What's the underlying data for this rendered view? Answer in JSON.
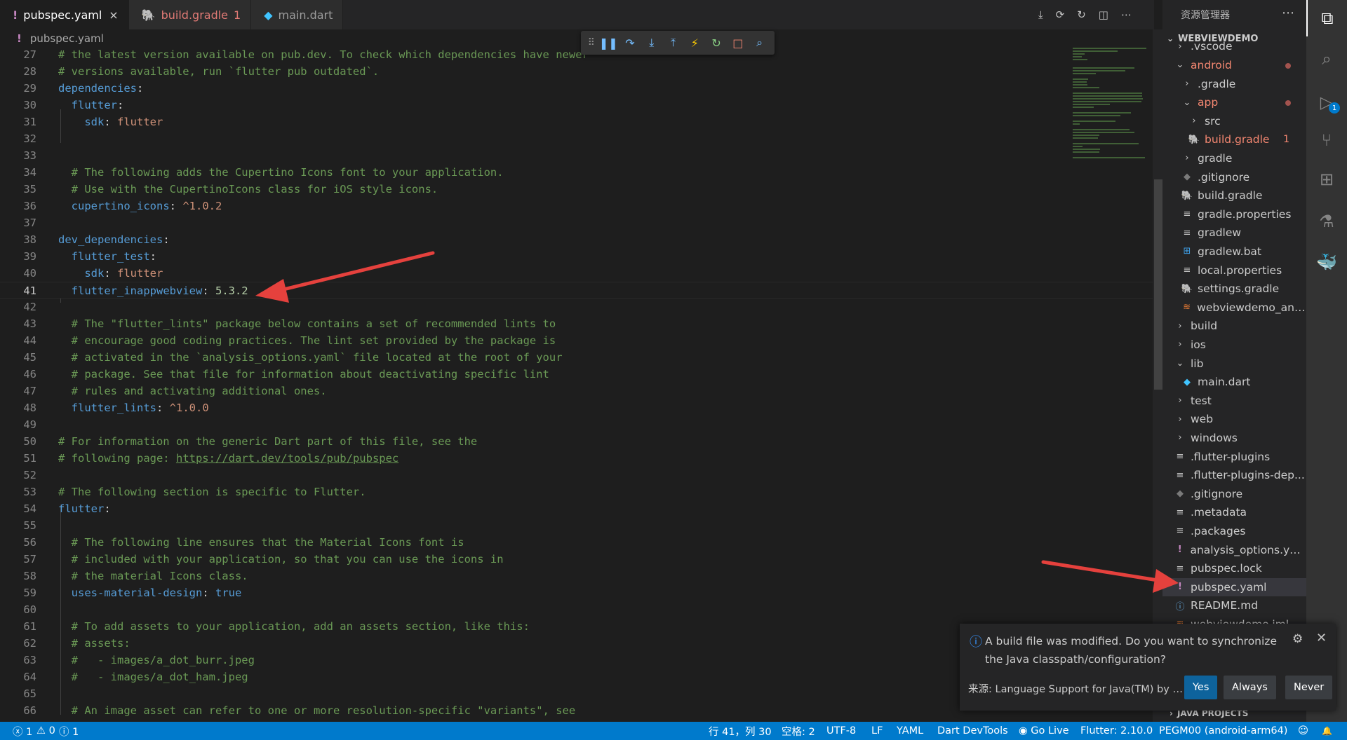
{
  "tabs": [
    {
      "label": "pubspec.yaml",
      "icon": "!",
      "icon_name": "yaml-icon",
      "active": true,
      "close": "×"
    },
    {
      "label": "build.gradle",
      "icon": "🐘",
      "icon_name": "gradle-icon",
      "badge": "1",
      "error": true
    },
    {
      "label": "main.dart",
      "icon": "◆",
      "icon_name": "dart-icon"
    }
  ],
  "tab_actions": [
    "⤓",
    "⟳",
    "↻",
    "◫",
    "⋯"
  ],
  "breadcrumb": {
    "icon": "!",
    "file": "pubspec.yaml"
  },
  "debug_toolbar": {
    "grip": "⠿",
    "pause": "❚❚",
    "step_over": "↷",
    "step_into": "⤓",
    "step_out": "⤒",
    "hot_reload": "⚡",
    "restart": "↻",
    "stop": "□",
    "inspect": "⌕"
  },
  "code_lines": [
    {
      "n": "27",
      "t": [
        {
          "c": "comment",
          "s": "# the latest version available on pub.dev. To check which dependencies have newer"
        }
      ]
    },
    {
      "n": "28",
      "t": [
        {
          "c": "comment",
          "s": "# versions available, run `flutter pub outdated`."
        }
      ]
    },
    {
      "n": "29",
      "t": [
        {
          "c": "key",
          "s": "dependencies"
        },
        {
          "c": "punct",
          "s": ":"
        }
      ]
    },
    {
      "n": "30",
      "t": [
        {
          "c": "plain",
          "s": "  "
        },
        {
          "c": "key",
          "s": "flutter"
        },
        {
          "c": "punct",
          "s": ":"
        }
      ]
    },
    {
      "n": "31",
      "t": [
        {
          "c": "plain",
          "s": "    "
        },
        {
          "c": "key",
          "s": "sdk"
        },
        {
          "c": "punct",
          "s": ": "
        },
        {
          "c": "plain",
          "s": "flutter"
        }
      ]
    },
    {
      "n": "32",
      "t": []
    },
    {
      "n": "33",
      "t": []
    },
    {
      "n": "34",
      "t": [
        {
          "c": "plain",
          "s": "  "
        },
        {
          "c": "comment",
          "s": "# The following adds the Cupertino Icons font to your application."
        }
      ]
    },
    {
      "n": "35",
      "t": [
        {
          "c": "plain",
          "s": "  "
        },
        {
          "c": "comment",
          "s": "# Use with the CupertinoIcons class for iOS style icons."
        }
      ]
    },
    {
      "n": "36",
      "t": [
        {
          "c": "plain",
          "s": "  "
        },
        {
          "c": "key",
          "s": "cupertino_icons"
        },
        {
          "c": "punct",
          "s": ": "
        },
        {
          "c": "plain",
          "s": "^1.0.2"
        }
      ]
    },
    {
      "n": "37",
      "t": []
    },
    {
      "n": "38",
      "t": [
        {
          "c": "key",
          "s": "dev_dependencies"
        },
        {
          "c": "punct",
          "s": ":"
        }
      ]
    },
    {
      "n": "39",
      "t": [
        {
          "c": "plain",
          "s": "  "
        },
        {
          "c": "key",
          "s": "flutter_test"
        },
        {
          "c": "punct",
          "s": ":"
        }
      ]
    },
    {
      "n": "40",
      "t": [
        {
          "c": "plain",
          "s": "    "
        },
        {
          "c": "key",
          "s": "sdk"
        },
        {
          "c": "punct",
          "s": ": "
        },
        {
          "c": "plain",
          "s": "flutter"
        }
      ]
    },
    {
      "n": "41",
      "t": [
        {
          "c": "plain",
          "s": "  "
        },
        {
          "c": "key",
          "s": "flutter_inappwebview"
        },
        {
          "c": "punct",
          "s": ": "
        },
        {
          "c": "num",
          "s": "5.3.2"
        }
      ],
      "current": true
    },
    {
      "n": "42",
      "t": []
    },
    {
      "n": "43",
      "t": [
        {
          "c": "plain",
          "s": "  "
        },
        {
          "c": "comment",
          "s": "# The \"flutter_lints\" package below contains a set of recommended lints to"
        }
      ]
    },
    {
      "n": "44",
      "t": [
        {
          "c": "plain",
          "s": "  "
        },
        {
          "c": "comment",
          "s": "# encourage good coding practices. The lint set provided by the package is"
        }
      ]
    },
    {
      "n": "45",
      "t": [
        {
          "c": "plain",
          "s": "  "
        },
        {
          "c": "comment",
          "s": "# activated in the `analysis_options.yaml` file located at the root of your"
        }
      ]
    },
    {
      "n": "46",
      "t": [
        {
          "c": "plain",
          "s": "  "
        },
        {
          "c": "comment",
          "s": "# package. See that file for information about deactivating specific lint"
        }
      ]
    },
    {
      "n": "47",
      "t": [
        {
          "c": "plain",
          "s": "  "
        },
        {
          "c": "comment",
          "s": "# rules and activating additional ones."
        }
      ]
    },
    {
      "n": "48",
      "t": [
        {
          "c": "plain",
          "s": "  "
        },
        {
          "c": "key",
          "s": "flutter_lints"
        },
        {
          "c": "punct",
          "s": ": "
        },
        {
          "c": "plain",
          "s": "^1.0.0"
        }
      ]
    },
    {
      "n": "49",
      "t": []
    },
    {
      "n": "50",
      "t": [
        {
          "c": "comment",
          "s": "# For information on the generic Dart part of this file, see the"
        }
      ]
    },
    {
      "n": "51",
      "t": [
        {
          "c": "comment",
          "s": "# following page: "
        },
        {
          "c": "link",
          "s": "https://dart.dev/tools/pub/pubspec"
        }
      ]
    },
    {
      "n": "52",
      "t": []
    },
    {
      "n": "53",
      "t": [
        {
          "c": "comment",
          "s": "# The following section is specific to Flutter."
        }
      ]
    },
    {
      "n": "54",
      "t": [
        {
          "c": "key",
          "s": "flutter"
        },
        {
          "c": "punct",
          "s": ":"
        }
      ]
    },
    {
      "n": "55",
      "t": []
    },
    {
      "n": "56",
      "t": [
        {
          "c": "plain",
          "s": "  "
        },
        {
          "c": "comment",
          "s": "# The following line ensures that the Material Icons font is"
        }
      ]
    },
    {
      "n": "57",
      "t": [
        {
          "c": "plain",
          "s": "  "
        },
        {
          "c": "comment",
          "s": "# included with your application, so that you can use the icons in"
        }
      ]
    },
    {
      "n": "58",
      "t": [
        {
          "c": "plain",
          "s": "  "
        },
        {
          "c": "comment",
          "s": "# the material Icons class."
        }
      ]
    },
    {
      "n": "59",
      "t": [
        {
          "c": "plain",
          "s": "  "
        },
        {
          "c": "key",
          "s": "uses-material-design"
        },
        {
          "c": "punct",
          "s": ": "
        },
        {
          "c": "bool",
          "s": "true"
        }
      ]
    },
    {
      "n": "60",
      "t": []
    },
    {
      "n": "61",
      "t": [
        {
          "c": "plain",
          "s": "  "
        },
        {
          "c": "comment",
          "s": "# To add assets to your application, add an assets section, like this:"
        }
      ]
    },
    {
      "n": "62",
      "t": [
        {
          "c": "plain",
          "s": "  "
        },
        {
          "c": "comment",
          "s": "# assets:"
        }
      ]
    },
    {
      "n": "63",
      "t": [
        {
          "c": "plain",
          "s": "  "
        },
        {
          "c": "comment",
          "s": "#   - images/a_dot_burr.jpeg"
        }
      ]
    },
    {
      "n": "64",
      "t": [
        {
          "c": "plain",
          "s": "  "
        },
        {
          "c": "comment",
          "s": "#   - images/a_dot_ham.jpeg"
        }
      ]
    },
    {
      "n": "65",
      "t": []
    },
    {
      "n": "66",
      "t": [
        {
          "c": "plain",
          "s": "  "
        },
        {
          "c": "comment",
          "s": "# An image asset can refer to one or more resolution-specific \"variants\", see"
        }
      ]
    }
  ],
  "explorer": {
    "title": "资源管理器",
    "more": "⋯",
    "project": "WEBVIEWDEMO",
    "items": [
      {
        "label": ".vscode",
        "depth": 2,
        "icon": "›",
        "icon_name": "chevron-right-icon"
      },
      {
        "label": "android",
        "depth": 2,
        "icon": "⌄",
        "icon_name": "chevron-down-icon",
        "error": true,
        "dot": true
      },
      {
        "label": ".gradle",
        "depth": 3,
        "icon": "›",
        "icon_name": "chevron-right-icon"
      },
      {
        "label": "app",
        "depth": 3,
        "icon": "⌄",
        "icon_name": "chevron-down-icon",
        "error": true,
        "dot": true
      },
      {
        "label": "src",
        "depth": 4,
        "icon": "›",
        "icon_name": "chevron-right-icon"
      },
      {
        "label": "build.gradle",
        "depth": 4,
        "icon": "🐘",
        "icon_name": "gradle-icon",
        "icon_class": "icon-gradle",
        "error": true,
        "badge": "1"
      },
      {
        "label": "gradle",
        "depth": 3,
        "icon": "›",
        "icon_name": "chevron-right-icon"
      },
      {
        "label": ".gitignore",
        "depth": 3,
        "icon": "◆",
        "icon_name": "git-icon",
        "icon_class": "icon-git"
      },
      {
        "label": "build.gradle",
        "depth": 3,
        "icon": "🐘",
        "icon_name": "gradle-icon",
        "icon_class": "icon-gradle"
      },
      {
        "label": "gradle.properties",
        "depth": 3,
        "icon": "≡",
        "icon_name": "file-lines-icon"
      },
      {
        "label": "gradlew",
        "depth": 3,
        "icon": "≡",
        "icon_name": "file-lines-icon"
      },
      {
        "label": "gradlew.bat",
        "depth": 3,
        "icon": "⊞",
        "icon_name": "windows-icon",
        "icon_class": "icon-win"
      },
      {
        "label": "local.properties",
        "depth": 3,
        "icon": "≡",
        "icon_name": "file-lines-icon"
      },
      {
        "label": "settings.gradle",
        "depth": 3,
        "icon": "🐘",
        "icon_name": "gradle-icon",
        "icon_class": "icon-gradle"
      },
      {
        "label": "webviewdemo_and...",
        "depth": 3,
        "icon": "≋",
        "icon_name": "rss-icon",
        "icon_class": "icon-rss"
      },
      {
        "label": "build",
        "depth": 2,
        "icon": "›",
        "icon_name": "chevron-right-icon"
      },
      {
        "label": "ios",
        "depth": 2,
        "icon": "›",
        "icon_name": "chevron-right-icon"
      },
      {
        "label": "lib",
        "depth": 2,
        "icon": "⌄",
        "icon_name": "chevron-down-icon"
      },
      {
        "label": "main.dart",
        "depth": 3,
        "icon": "◆",
        "icon_name": "dart-icon",
        "icon_class": "icon-dart"
      },
      {
        "label": "test",
        "depth": 2,
        "icon": "›",
        "icon_name": "chevron-right-icon"
      },
      {
        "label": "web",
        "depth": 2,
        "icon": "›",
        "icon_name": "chevron-right-icon"
      },
      {
        "label": "windows",
        "depth": 2,
        "icon": "›",
        "icon_name": "chevron-right-icon"
      },
      {
        "label": ".flutter-plugins",
        "depth": 2,
        "icon": "≡",
        "icon_name": "file-lines-icon"
      },
      {
        "label": ".flutter-plugins-dep...",
        "depth": 2,
        "icon": "≡",
        "icon_name": "file-lines-icon"
      },
      {
        "label": ".gitignore",
        "depth": 2,
        "icon": "◆",
        "icon_name": "git-icon",
        "icon_class": "icon-git"
      },
      {
        "label": ".metadata",
        "depth": 2,
        "icon": "≡",
        "icon_name": "file-lines-icon"
      },
      {
        "label": ".packages",
        "depth": 2,
        "icon": "≡",
        "icon_name": "file-lines-icon"
      },
      {
        "label": "analysis_options.yaml",
        "depth": 2,
        "icon": "!",
        "icon_name": "yaml-icon",
        "icon_class": "icon-yaml"
      },
      {
        "label": "pubspec.lock",
        "depth": 2,
        "icon": "≡",
        "icon_name": "file-lines-icon"
      },
      {
        "label": "pubspec.yaml",
        "depth": 2,
        "icon": "!",
        "icon_name": "yaml-icon",
        "icon_class": "icon-yaml",
        "selected": true
      },
      {
        "label": "README.md",
        "depth": 2,
        "icon": "ⓘ",
        "icon_name": "info-icon",
        "icon_class": "icon-info"
      },
      {
        "label": "webviewdemo.iml",
        "depth": 2,
        "icon": "≋",
        "icon_name": "rss-icon",
        "icon_class": "icon-rss"
      }
    ],
    "java_projects": "JAVA PROJECTS"
  },
  "activity_bar": [
    {
      "icon": "⧉",
      "name": "explorer-icon",
      "active": true
    },
    {
      "icon": "⌕",
      "name": "search-icon"
    },
    {
      "icon": "▷",
      "name": "run-debug-icon",
      "badge": "1"
    },
    {
      "icon": "⑂",
      "name": "source-control-icon"
    },
    {
      "icon": "⊞",
      "name": "extensions-icon"
    },
    {
      "icon": "⚗",
      "name": "testing-icon"
    },
    {
      "icon": "🐳",
      "name": "docker-icon"
    }
  ],
  "notification": {
    "icon": "ⓘ",
    "message": "A build file was modified. Do you want to synchronize the Java classpath/configuration?",
    "gear": "⚙",
    "close": "✕",
    "source": "来源: Language Support for Java(TM) by Red Hat",
    "buttons": {
      "yes": "Yes",
      "always": "Always",
      "never": "Never"
    }
  },
  "status_bar": {
    "errors": "ⓧ 1",
    "warnings": "⚠ 0",
    "infos": "ⓘ 1",
    "position": "行 41，列 30",
    "spaces": "空格: 2",
    "encoding": "UTF-8",
    "eol": "LF",
    "language": "YAML",
    "devtools": "Dart DevTools",
    "golive": "◉ Go Live",
    "flutter": "Flutter: 2.10.0",
    "device": "PEGM00 (android-arm64)",
    "feedback": "☺",
    "bell": "🔔"
  },
  "colors": {
    "accent": "#007acc",
    "arrow": "#e5413d",
    "error_text": "#f48771"
  }
}
